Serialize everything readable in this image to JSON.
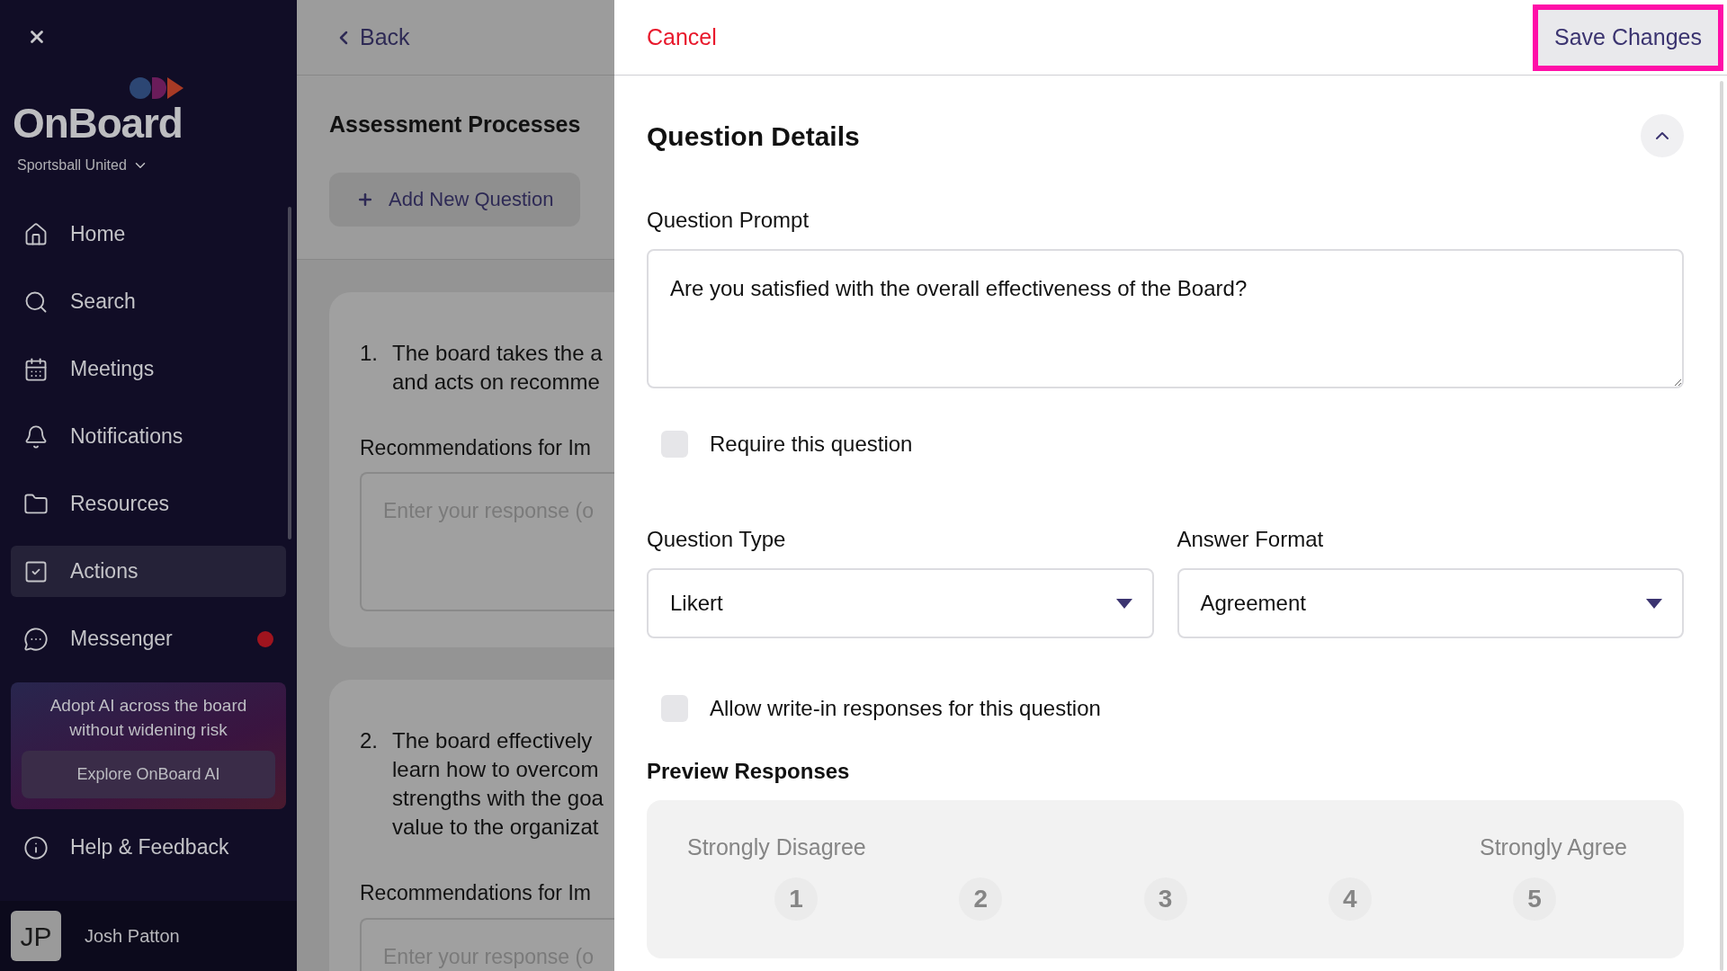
{
  "sidebar": {
    "logo": "OnBoard",
    "organization": "Sportsball United",
    "items": [
      {
        "label": "Home",
        "selected": false,
        "badge": false
      },
      {
        "label": "Search",
        "selected": false,
        "badge": false
      },
      {
        "label": "Meetings",
        "selected": false,
        "badge": false
      },
      {
        "label": "Notifications",
        "selected": false,
        "badge": false
      },
      {
        "label": "Resources",
        "selected": false,
        "badge": false
      },
      {
        "label": "Actions",
        "selected": true,
        "badge": false
      },
      {
        "label": "Messenger",
        "selected": false,
        "badge": true
      }
    ],
    "promo": {
      "text": "Adopt AI across the board without widening risk",
      "button": "Explore OnBoard AI"
    },
    "help": "Help & Feedback",
    "user": {
      "initials": "JP",
      "name": "Josh Patton"
    }
  },
  "background_page": {
    "back": "Back",
    "title": "Assessment Processes",
    "add_button": "Add New Question",
    "questions": [
      {
        "number": "1.",
        "lines": [
          "The board takes the a",
          "and acts on recomme"
        ],
        "field_label": "Recommendations for Im",
        "placeholder": "Enter your response (o"
      },
      {
        "number": "2.",
        "lines": [
          "The board effectively",
          "learn how to overcom",
          "strengths with the goa",
          "value to the organizat"
        ],
        "field_label": "Recommendations for Im",
        "placeholder": "Enter your response (o"
      }
    ]
  },
  "panel": {
    "cancel": "Cancel",
    "save": "Save Changes",
    "save_highlighted": true,
    "section_title": "Question Details",
    "expanded": true,
    "prompt_label": "Question Prompt",
    "prompt_value": "Are you satisfied with the overall effectiveness of the Board?",
    "require": {
      "label": "Require this question",
      "checked": false
    },
    "question_type": {
      "label": "Question Type",
      "value": "Likert"
    },
    "answer_format": {
      "label": "Answer Format",
      "value": "Agreement"
    },
    "write_in": {
      "label": "Allow write-in responses for this question",
      "checked": false
    },
    "preview": {
      "title": "Preview Responses",
      "low_label": "Strongly Disagree",
      "high_label": "Strongly Agree",
      "options": [
        "1",
        "2",
        "3",
        "4",
        "5"
      ]
    }
  }
}
